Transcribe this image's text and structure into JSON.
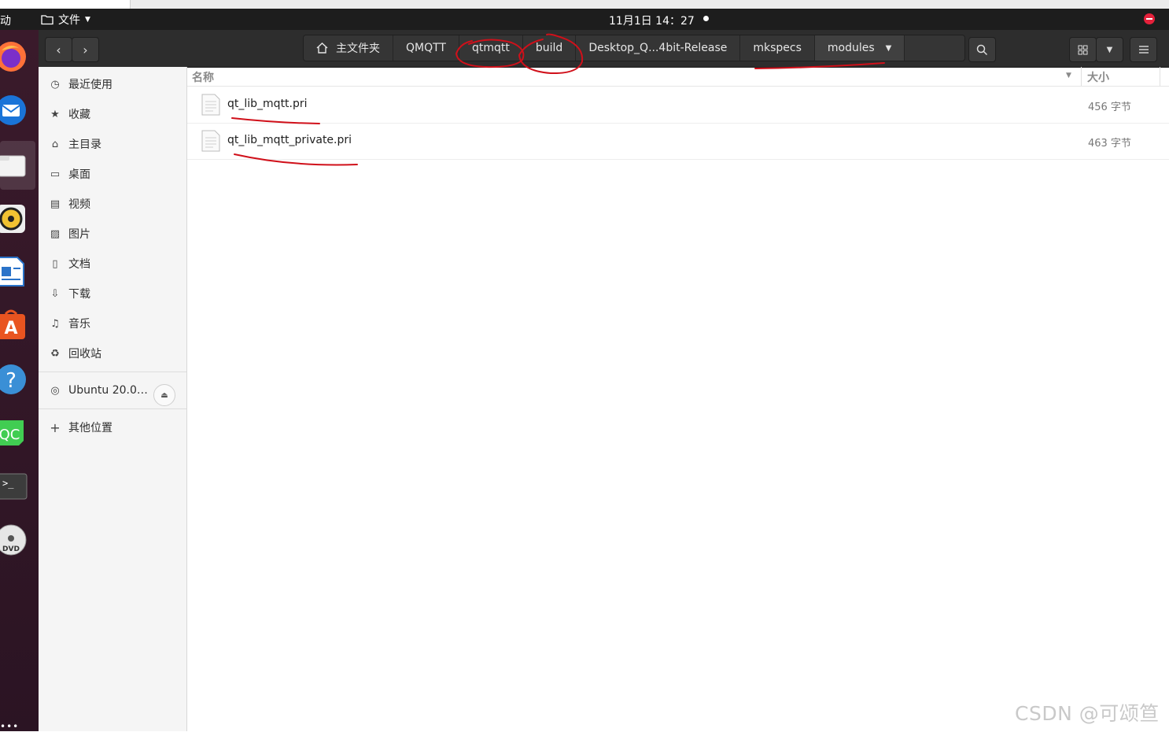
{
  "topbar": {
    "activities": "活动",
    "app_menu": "文件",
    "clock": "11月1日  14：27"
  },
  "dock": {
    "apps": [
      "firefox-icon",
      "thunderbird-icon",
      "files-icon",
      "rhythmbox-icon",
      "libreoffice-writer-icon",
      "ubuntu-software-icon",
      "help-icon",
      "qtcreator-icon",
      "terminal-icon",
      "dvd-icon"
    ],
    "qc_label": "QC",
    "dvd_label": "DVD",
    "show_apps": "•••"
  },
  "nav": {
    "back": "‹",
    "forward": "›"
  },
  "path": {
    "items": [
      {
        "label": "主文件夹",
        "icon": "home-icon"
      },
      {
        "label": "QMQTT"
      },
      {
        "label": "qtmqtt"
      },
      {
        "label": "build"
      },
      {
        "label": "Desktop_Q...4bit-Release"
      },
      {
        "label": "mkspecs"
      },
      {
        "label": "modules",
        "current": true
      }
    ]
  },
  "sidebar": {
    "items": [
      {
        "label": "最近使用",
        "icon": "clock-icon"
      },
      {
        "label": "收藏",
        "icon": "star-icon"
      },
      {
        "label": "主目录",
        "icon": "home-icon"
      },
      {
        "label": "桌面",
        "icon": "desktop-icon"
      },
      {
        "label": "视频",
        "icon": "video-icon"
      },
      {
        "label": "图片",
        "icon": "picture-icon"
      },
      {
        "label": "文档",
        "icon": "document-icon"
      },
      {
        "label": "下载",
        "icon": "download-icon"
      },
      {
        "label": "音乐",
        "icon": "music-icon"
      },
      {
        "label": "回收站",
        "icon": "trash-icon"
      }
    ],
    "device": {
      "label": "Ubuntu 20.0…",
      "icon": "disc-icon"
    },
    "other": {
      "label": "其他位置",
      "icon": "plus-icon"
    }
  },
  "list": {
    "columns": {
      "name": "名称",
      "size": "大小"
    },
    "files": [
      {
        "name": "qt_lib_mqtt.pri",
        "size": "456 字节"
      },
      {
        "name": "qt_lib_mqtt_private.pri",
        "size": "463 字节"
      }
    ]
  },
  "watermark": "CSDN @可颂笪",
  "annotation_color": "#d0101a"
}
